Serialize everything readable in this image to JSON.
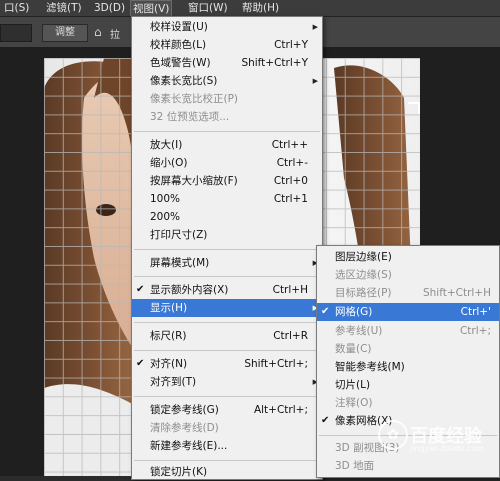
{
  "menubar": {
    "items": [
      {
        "label": "口(S)"
      },
      {
        "label": "滤镜(T)"
      },
      {
        "label": "3D(D)"
      },
      {
        "label": "视图(V)"
      },
      {
        "label": "窗口(W)"
      },
      {
        "label": "帮助(H)"
      }
    ]
  },
  "optbar": {
    "button_label": "调整",
    "tail_label": "拉"
  },
  "view_menu": {
    "items": [
      {
        "label": "校样设置(U)",
        "shortcut": "",
        "submenu": true,
        "disabled": false
      },
      {
        "label": "校样颜色(L)",
        "shortcut": "Ctrl+Y",
        "submenu": false,
        "disabled": false
      },
      {
        "label": "色域警告(W)",
        "shortcut": "Shift+Ctrl+Y",
        "submenu": false,
        "disabled": false
      },
      {
        "label": "像素长宽比(S)",
        "shortcut": "",
        "submenu": true,
        "disabled": false
      },
      {
        "label": "像素长宽比校正(P)",
        "shortcut": "",
        "submenu": false,
        "disabled": true
      },
      {
        "label": "32 位预览选项...",
        "shortcut": "",
        "submenu": false,
        "disabled": true
      },
      {
        "label": "放大(I)",
        "shortcut": "Ctrl++",
        "submenu": false,
        "disabled": false
      },
      {
        "label": "缩小(O)",
        "shortcut": "Ctrl+-",
        "submenu": false,
        "disabled": false
      },
      {
        "label": "按屏幕大小缩放(F)",
        "shortcut": "Ctrl+0",
        "submenu": false,
        "disabled": false
      },
      {
        "label": "100%",
        "shortcut": "Ctrl+1",
        "submenu": false,
        "disabled": false
      },
      {
        "label": "200%",
        "shortcut": "",
        "submenu": false,
        "disabled": false
      },
      {
        "label": "打印尺寸(Z)",
        "shortcut": "",
        "submenu": false,
        "disabled": false
      },
      {
        "label": "屏幕模式(M)",
        "shortcut": "",
        "submenu": true,
        "disabled": false
      },
      {
        "label": "显示额外内容(X)",
        "shortcut": "Ctrl+H",
        "submenu": false,
        "disabled": false,
        "checked": true
      },
      {
        "label": "显示(H)",
        "shortcut": "",
        "submenu": true,
        "disabled": false,
        "highlighted": true
      },
      {
        "label": "标尺(R)",
        "shortcut": "Ctrl+R",
        "submenu": false,
        "disabled": false
      },
      {
        "label": "对齐(N)",
        "shortcut": "Shift+Ctrl+;",
        "submenu": false,
        "disabled": false,
        "checked": true
      },
      {
        "label": "对齐到(T)",
        "shortcut": "",
        "submenu": true,
        "disabled": false
      },
      {
        "label": "锁定参考线(G)",
        "shortcut": "Alt+Ctrl+;",
        "submenu": false,
        "disabled": false
      },
      {
        "label": "清除参考线(D)",
        "shortcut": "",
        "submenu": false,
        "disabled": true
      },
      {
        "label": "新建参考线(E)...",
        "shortcut": "",
        "submenu": false,
        "disabled": false
      },
      {
        "label": "锁定切片(K)",
        "shortcut": "",
        "submenu": false,
        "disabled": false
      }
    ]
  },
  "show_submenu": {
    "items": [
      {
        "label": "图层边缘(E)",
        "shortcut": "",
        "disabled": false
      },
      {
        "label": "选区边缘(S)",
        "shortcut": "",
        "disabled": true
      },
      {
        "label": "目标路径(P)",
        "shortcut": "Shift+Ctrl+H",
        "disabled": true
      },
      {
        "label": "网格(G)",
        "shortcut": "Ctrl+'",
        "disabled": false,
        "checked": true,
        "highlighted": true
      },
      {
        "label": "参考线(U)",
        "shortcut": "Ctrl+;",
        "disabled": true
      },
      {
        "label": "数量(C)",
        "shortcut": "",
        "disabled": true
      },
      {
        "label": "智能参考线(M)",
        "shortcut": "",
        "disabled": false
      },
      {
        "label": "切片(L)",
        "shortcut": "",
        "disabled": false
      },
      {
        "label": "注释(O)",
        "shortcut": "",
        "disabled": true
      },
      {
        "label": "像素网格(X)",
        "shortcut": "",
        "disabled": false,
        "checked": true
      },
      {
        "label": "3D 副视图(3)",
        "shortcut": "",
        "disabled": true
      },
      {
        "label": "3D 地面",
        "shortcut": "",
        "disabled": true
      }
    ]
  },
  "watermark": {
    "text": "百度经验",
    "sub": "jingyan.baidu.com"
  },
  "icons": {
    "checkmark": "✔",
    "submenu_arrow": "▶",
    "toolbar_icon": "⌂"
  }
}
